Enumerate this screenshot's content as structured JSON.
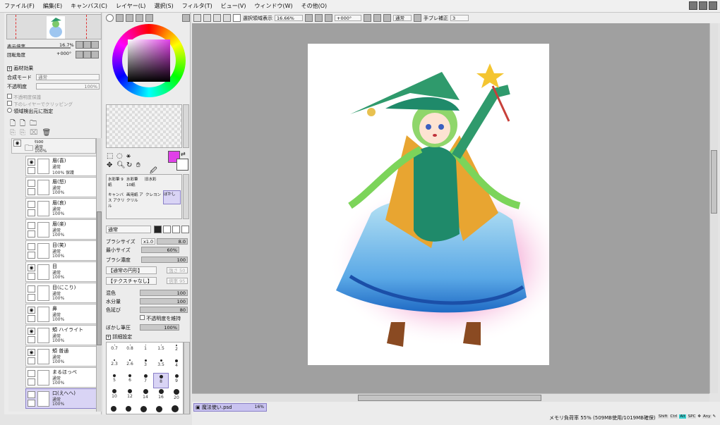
{
  "menubar": {
    "items": [
      "ファイル(F)",
      "編集(E)",
      "キャンバス(C)",
      "レイヤー(L)",
      "選択(S)",
      "フィルタ(T)",
      "ビュー(V)",
      "ウィンドウ(W)",
      "その他(O)"
    ]
  },
  "navigator": {
    "zoom_label": "表示倍率",
    "zoom_value": "16.7%",
    "rotate_label": "回転角度",
    "rotate_value": "+000°"
  },
  "paper_effect": {
    "header": "画材効果",
    "blend_label": "合成モード",
    "blend_value": "通常",
    "opacity_label": "不透明度",
    "opacity_value": "100%",
    "protect_label": "不透明度保護",
    "clip_label": "下のレイヤーでクリッピング",
    "detect_label": "領域検出元に指定"
  },
  "layers": [
    {
      "name": "ｾﾙ00",
      "mode": "通常",
      "opacity": "100%",
      "folder": true
    },
    {
      "name": "眉(喜)",
      "mode": "通常",
      "opacity": "100% 保護",
      "visible": true
    },
    {
      "name": "眉(怒)",
      "mode": "通常",
      "opacity": "100%",
      "visible": false
    },
    {
      "name": "眉(哀)",
      "mode": "通常",
      "opacity": "100%",
      "visible": false
    },
    {
      "name": "眉(楽)",
      "mode": "通常",
      "opacity": "100%",
      "visible": false
    },
    {
      "name": "目(笑)",
      "mode": "通常",
      "opacity": "100%",
      "visible": false
    },
    {
      "name": "目",
      "mode": "通常",
      "opacity": "100%",
      "visible": true
    },
    {
      "name": "目(にこり)",
      "mode": "通常",
      "opacity": "100%",
      "visible": false
    },
    {
      "name": "鼻",
      "mode": "通常",
      "opacity": "100%",
      "visible": true
    },
    {
      "name": "頬 ハイライト",
      "mode": "通常",
      "opacity": "100%",
      "visible": true
    },
    {
      "name": "頬 普通",
      "mode": "通常",
      "opacity": "100%",
      "visible": true
    },
    {
      "name": "まるほっぺ",
      "mode": "通常",
      "opacity": "100%",
      "visible": false
    },
    {
      "name": "口(えへへ)",
      "mode": "通常",
      "opacity": "100%",
      "visible": false,
      "selected": true
    }
  ],
  "tools": {
    "row1": [
      "水彩筆 9紙",
      "水彩筆 10紙",
      "旧水彩"
    ],
    "row2": [
      "キャンバス アクリル",
      "画用紙 アクリル",
      "クレヨン",
      "ぼかし"
    ]
  },
  "brush": {
    "mode": "通常",
    "size_label": "ブラシサイズ",
    "size_mult": "x1.0",
    "size_value": "8.0",
    "min_size_label": "最小サイズ",
    "min_size_value": "60%",
    "density_label": "ブラシ濃度",
    "density_value": "100",
    "shape": "【通常の円形】",
    "shape_amt": "強さ 50",
    "texture": "【テクスチャなし】",
    "texture_amt": "倍率 95",
    "mix_label": "混色",
    "mix_value": "100",
    "water_label": "水分量",
    "water_value": "100",
    "persist_label": "色延び",
    "persist_value": "80",
    "keep_opacity": "不透明度を維持",
    "blur_label": "ぼかし筆圧",
    "blur_value": "100%",
    "detail": "詳細設定",
    "sizes": [
      "0.7",
      "0.8",
      "1",
      "1.5",
      "2",
      "2.3",
      "2.6",
      "3",
      "3.5",
      "4",
      "5",
      "6",
      "7",
      "8",
      "9",
      "10",
      "12",
      "14",
      "16",
      "20"
    ]
  },
  "toolbar": {
    "select_display": "選択領域表示",
    "zoom": "16.66%",
    "rotate": "+000°",
    "mode": "通常",
    "stabilizer_label": "手ブレ補正",
    "stabilizer_value": "3"
  },
  "status": {
    "file": "魔法使い.psd",
    "file_zoom": "16%",
    "memory": "メモリ負荷率 55% (509MB使用/1019MB確保)",
    "keys": [
      "Shift",
      "Ctrl",
      "Alt",
      "SPC",
      "Any"
    ]
  },
  "colors": {
    "current_color": "#e040e8",
    "accent": "#8a80c8"
  }
}
